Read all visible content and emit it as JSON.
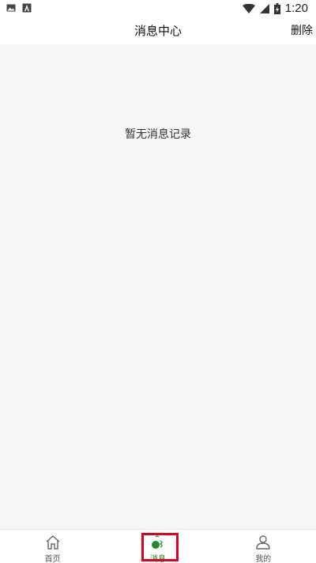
{
  "status_bar": {
    "time": "1:20",
    "left_icons": [
      "image-icon",
      "app-icon"
    ],
    "right_icons": [
      "wifi-icon",
      "signal-icon",
      "battery-icon"
    ]
  },
  "header": {
    "title": "消息中心",
    "delete_label": "删除"
  },
  "main": {
    "empty_message": "暂无消息记录"
  },
  "bottom_nav": {
    "items": [
      {
        "label": "首页",
        "icon": "home-icon",
        "active": false
      },
      {
        "label": "消息",
        "icon": "message-icon",
        "active": true
      },
      {
        "label": "我的",
        "icon": "profile-icon",
        "active": false
      }
    ]
  },
  "colors": {
    "accent": "#1e8a2c",
    "background": "#f6f6f6",
    "highlight": "#e3001b"
  }
}
